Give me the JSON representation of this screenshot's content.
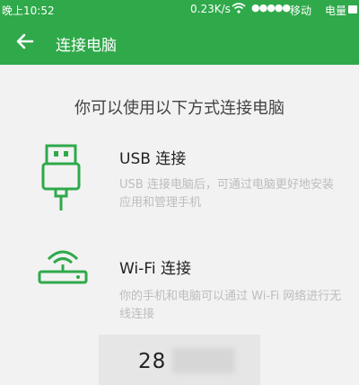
{
  "status_bar": {
    "time": "晚上10:52",
    "speed": "0.23K/s",
    "signal": "●●●●●",
    "carrier": "移动",
    "battery_label": "电量"
  },
  "app_bar": {
    "title": "连接电脑"
  },
  "heading": "你可以使用以下方式连接电脑",
  "usb": {
    "title": "USB 连接",
    "description": "USB 连接电脑后，可通过电脑更好地安装应用和管理手机"
  },
  "wifi": {
    "title": "Wi-Fi 连接",
    "description": "你的手机和电脑可以通过 Wi-Fi 网络进行无线连接"
  },
  "connection_code": {
    "visible": "28"
  },
  "colors": {
    "brand": "#2fa94a",
    "background": "#f2f2f2",
    "secondary_text": "#bdbdbd"
  },
  "icons": [
    "arrow-left-icon",
    "usb-icon",
    "wifi-router-icon",
    "wifi-status-icon",
    "battery-icon"
  ]
}
